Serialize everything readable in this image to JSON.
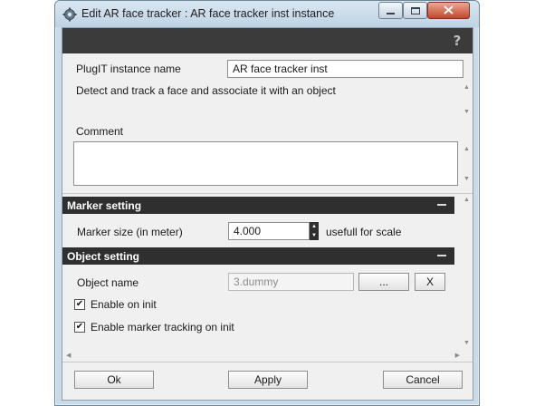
{
  "window": {
    "title": "Edit AR face tracker : AR face tracker inst instance",
    "icon": "gear-icon",
    "controls": {
      "minimize": "minimize-icon",
      "maximize": "maximize-icon",
      "close": "close-icon"
    }
  },
  "helpbar": {
    "icon": "help-icon",
    "glyph": "?"
  },
  "instance": {
    "name_label": "PlugIT instance name",
    "name_value": "AR face tracker inst",
    "description": "Detect and track a face and associate it with an object",
    "comment_label": "Comment",
    "comment_value": ""
  },
  "marker_section": {
    "title": "Marker setting",
    "size_label": "Marker size (in meter)",
    "size_value": "4.000",
    "size_hint": "usefull for scale"
  },
  "object_section": {
    "title": "Object setting",
    "name_label": "Object name",
    "name_value": "3.dummy",
    "browse_label": "...",
    "clear_label": "X",
    "enable_init_label": "Enable on init",
    "enable_init_checked": true,
    "enable_tracking_label": "Enable marker tracking on init",
    "enable_tracking_checked": true
  },
  "footer": {
    "ok_label": "Ok",
    "apply_label": "Apply",
    "cancel_label": "Cancel"
  },
  "colors": {
    "titlebar": "#c9dbe9",
    "section_header": "#2f2f2f",
    "panel": "#f0f0f0",
    "close_button": "#c4462b"
  }
}
